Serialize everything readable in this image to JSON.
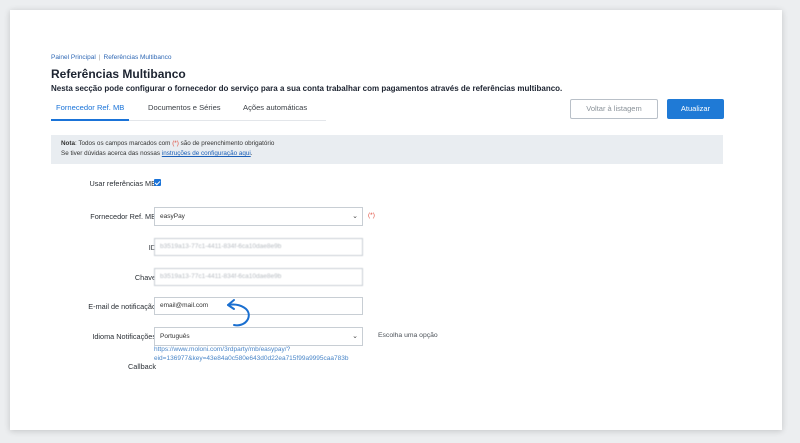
{
  "breadcrumb": {
    "home": "Painel Principal",
    "separator": "|",
    "current": "Referências Multibanco"
  },
  "page": {
    "title": "Referências Multibanco",
    "subtitle": "Nesta secção pode configurar o fornecedor do serviço para a sua conta trabalhar com pagamentos através de referências multibanco."
  },
  "tabs": [
    {
      "label": "Fornecedor Ref. MB",
      "active": true
    },
    {
      "label": "Documentos e Séries",
      "active": false
    },
    {
      "label": "Ações automáticas",
      "active": false
    }
  ],
  "buttons": {
    "back": "Voltar à listagem",
    "update": "Atualizar"
  },
  "note": {
    "prefix": "Nota",
    "line1_a": ": Todos os campos marcados com ",
    "required_marker": "(*)",
    "line1_b": " são de preenchimento obrigatório",
    "line2_text": "Se tiver dúvidas acerca das nossas ",
    "line2_link": "instruções de configuração aqui",
    "line2_end": "."
  },
  "form": {
    "use_mb": {
      "label": "Usar referências MB",
      "checked": true
    },
    "provider": {
      "label": "Fornecedor Ref. MB",
      "value": "easyPay",
      "required": "(*)"
    },
    "id": {
      "label": "ID",
      "value": "b3519a13-77c1-4411-834f-6ca10dae8e9b"
    },
    "key": {
      "label": "Chave",
      "value": "b3519a13-77c1-4411-834f-6ca10dae8e9b"
    },
    "email": {
      "label": "E-mail de notificação",
      "value": "email@mail.com"
    },
    "language": {
      "label": "Idioma Notificações",
      "value": "Português",
      "hint": "Escolha uma opção"
    },
    "callback": {
      "label": "Callback",
      "line1": "https://www.moloni.com/3rdparty/mb/easypay/?",
      "line2": "eid=136977&key=43e84a0c580e643d0d22ea715f99a9995caa783b"
    }
  },
  "colors": {
    "accent": "#1a73d8",
    "required": "#e04a3a",
    "note_bg": "#e9edf1"
  }
}
